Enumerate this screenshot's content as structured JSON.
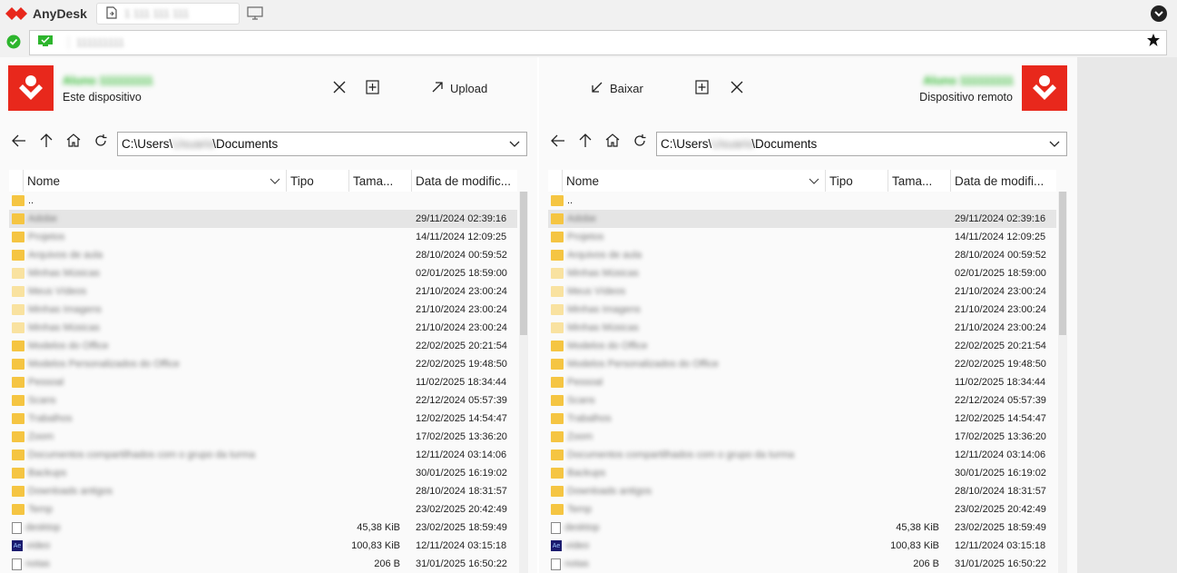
{
  "app": {
    "name": "AnyDesk",
    "tab_label": "1 111 111 111",
    "address": "111111111",
    "brand_color": "#e8281c"
  },
  "local": {
    "device_name": "Aluno 111111111",
    "device_label": "Este dispositivo",
    "upload_label": "Upload",
    "path_prefix": "C:\\Users\\",
    "path_user": "Usuario",
    "path_suffix": "\\Documents"
  },
  "remote": {
    "device_name": "Aluno 111111111",
    "device_label": "Dispositivo remoto",
    "download_label": "Baixar",
    "path_prefix": "C:\\Users\\",
    "path_user": "Usuario",
    "path_suffix": "\\Documents"
  },
  "columns": {
    "name": "Nome",
    "type": "Tipo",
    "size": "Tama...",
    "date": "Data de modific...",
    "date_remote": "Data de modifi..."
  },
  "icons": {
    "close": "close-icon",
    "new_folder": "new-folder-icon",
    "upload": "upload-arrow-icon",
    "download": "download-arrow-icon",
    "back": "arrow-left-icon",
    "up": "arrow-up-icon",
    "home": "home-icon",
    "refresh": "refresh-icon"
  },
  "files": [
    {
      "name": "..",
      "size": "",
      "date": "",
      "kind": "folder",
      "light": false,
      "blur": false
    },
    {
      "name": "Adobe",
      "size": "",
      "date": "29/11/2024 02:39:16",
      "kind": "folder",
      "light": false,
      "blur": true,
      "selected": true
    },
    {
      "name": "Projetos",
      "size": "",
      "date": "14/11/2024 12:09:25",
      "kind": "folder",
      "light": false,
      "blur": true
    },
    {
      "name": "Arquivos de aula",
      "size": "",
      "date": "28/10/2024 00:59:52",
      "kind": "folder",
      "light": false,
      "blur": true
    },
    {
      "name": "Minhas Músicas",
      "size": "",
      "date": "02/01/2025 18:59:00",
      "kind": "folder",
      "light": true,
      "blur": true
    },
    {
      "name": "Meus Vídeos",
      "size": "",
      "date": "21/10/2024 23:00:24",
      "kind": "folder",
      "light": true,
      "blur": true
    },
    {
      "name": "Minhas Imagens",
      "size": "",
      "date": "21/10/2024 23:00:24",
      "kind": "folder",
      "light": true,
      "blur": true
    },
    {
      "name": "Minhas Músicas",
      "size": "",
      "date": "21/10/2024 23:00:24",
      "kind": "folder",
      "light": true,
      "blur": true
    },
    {
      "name": "Modelos do Office",
      "size": "",
      "date": "22/02/2025 20:21:54",
      "kind": "folder",
      "light": false,
      "blur": true
    },
    {
      "name": "Modelos Personalizados do Office",
      "size": "",
      "date": "22/02/2025 19:48:50",
      "kind": "folder",
      "light": false,
      "blur": true
    },
    {
      "name": "Pessoal",
      "size": "",
      "date": "11/02/2025 18:34:44",
      "kind": "folder",
      "light": false,
      "blur": true
    },
    {
      "name": "Scans",
      "size": "",
      "date": "22/12/2024 05:57:39",
      "kind": "folder",
      "light": false,
      "blur": true
    },
    {
      "name": "Trabalhos",
      "size": "",
      "date": "12/02/2025 14:54:47",
      "kind": "folder",
      "light": false,
      "blur": true
    },
    {
      "name": "Zoom",
      "size": "",
      "date": "17/02/2025 13:36:20",
      "kind": "folder",
      "light": false,
      "blur": true
    },
    {
      "name": "Documentos compartilhados com o grupo da turma",
      "size": "",
      "date": "12/11/2024 03:14:06",
      "kind": "folder",
      "light": false,
      "blur": true
    },
    {
      "name": "Backups",
      "size": "",
      "date": "30/01/2025 16:19:02",
      "kind": "folder",
      "light": false,
      "blur": true
    },
    {
      "name": "Downloads antigos",
      "size": "",
      "date": "28/10/2024 18:31:57",
      "kind": "folder",
      "light": false,
      "blur": true
    },
    {
      "name": "Temp",
      "size": "",
      "date": "23/02/2025 20:42:49",
      "kind": "folder",
      "light": false,
      "blur": true
    },
    {
      "name": "desktop",
      "size": "45,38 KiB",
      "date": "23/02/2025 18:59:49",
      "kind": "file",
      "light": false,
      "blur": true
    },
    {
      "name": "video",
      "size": "100,83 KiB",
      "date": "12/11/2024 03:15:18",
      "kind": "ae",
      "light": false,
      "blur": true
    },
    {
      "name": "notas",
      "size": "206 B",
      "date": "31/01/2025 16:50:22",
      "kind": "file",
      "light": false,
      "blur": true
    }
  ]
}
